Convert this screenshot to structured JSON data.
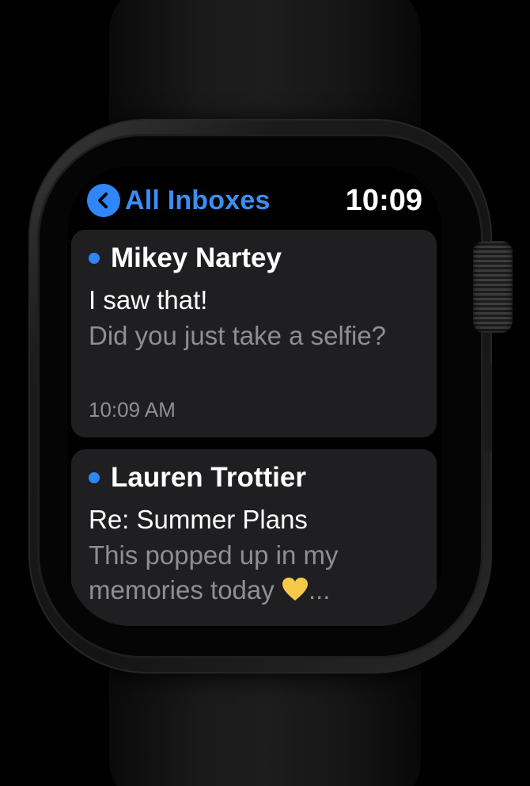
{
  "nav": {
    "back_label": "All Inboxes",
    "back_icon": "chevron-left-icon",
    "time": "10:09"
  },
  "messages": [
    {
      "sender": "Mikey Nartey",
      "subject": "I saw that!",
      "preview": "Did you just take a selfie?",
      "timestamp": "10:09 AM",
      "unread": true
    },
    {
      "sender": "Lauren Trottier",
      "subject": "Re: Summer Plans",
      "preview_before_emoji": "This popped up in my memories today",
      "preview_emoji": "yellow-heart-icon",
      "preview_after_emoji": "...",
      "unread": true
    }
  ],
  "colors": {
    "accent": "#2f86f6",
    "card_background": "#1f1f21",
    "secondary_text": "#8f8f93",
    "heart": "#f7c948"
  }
}
